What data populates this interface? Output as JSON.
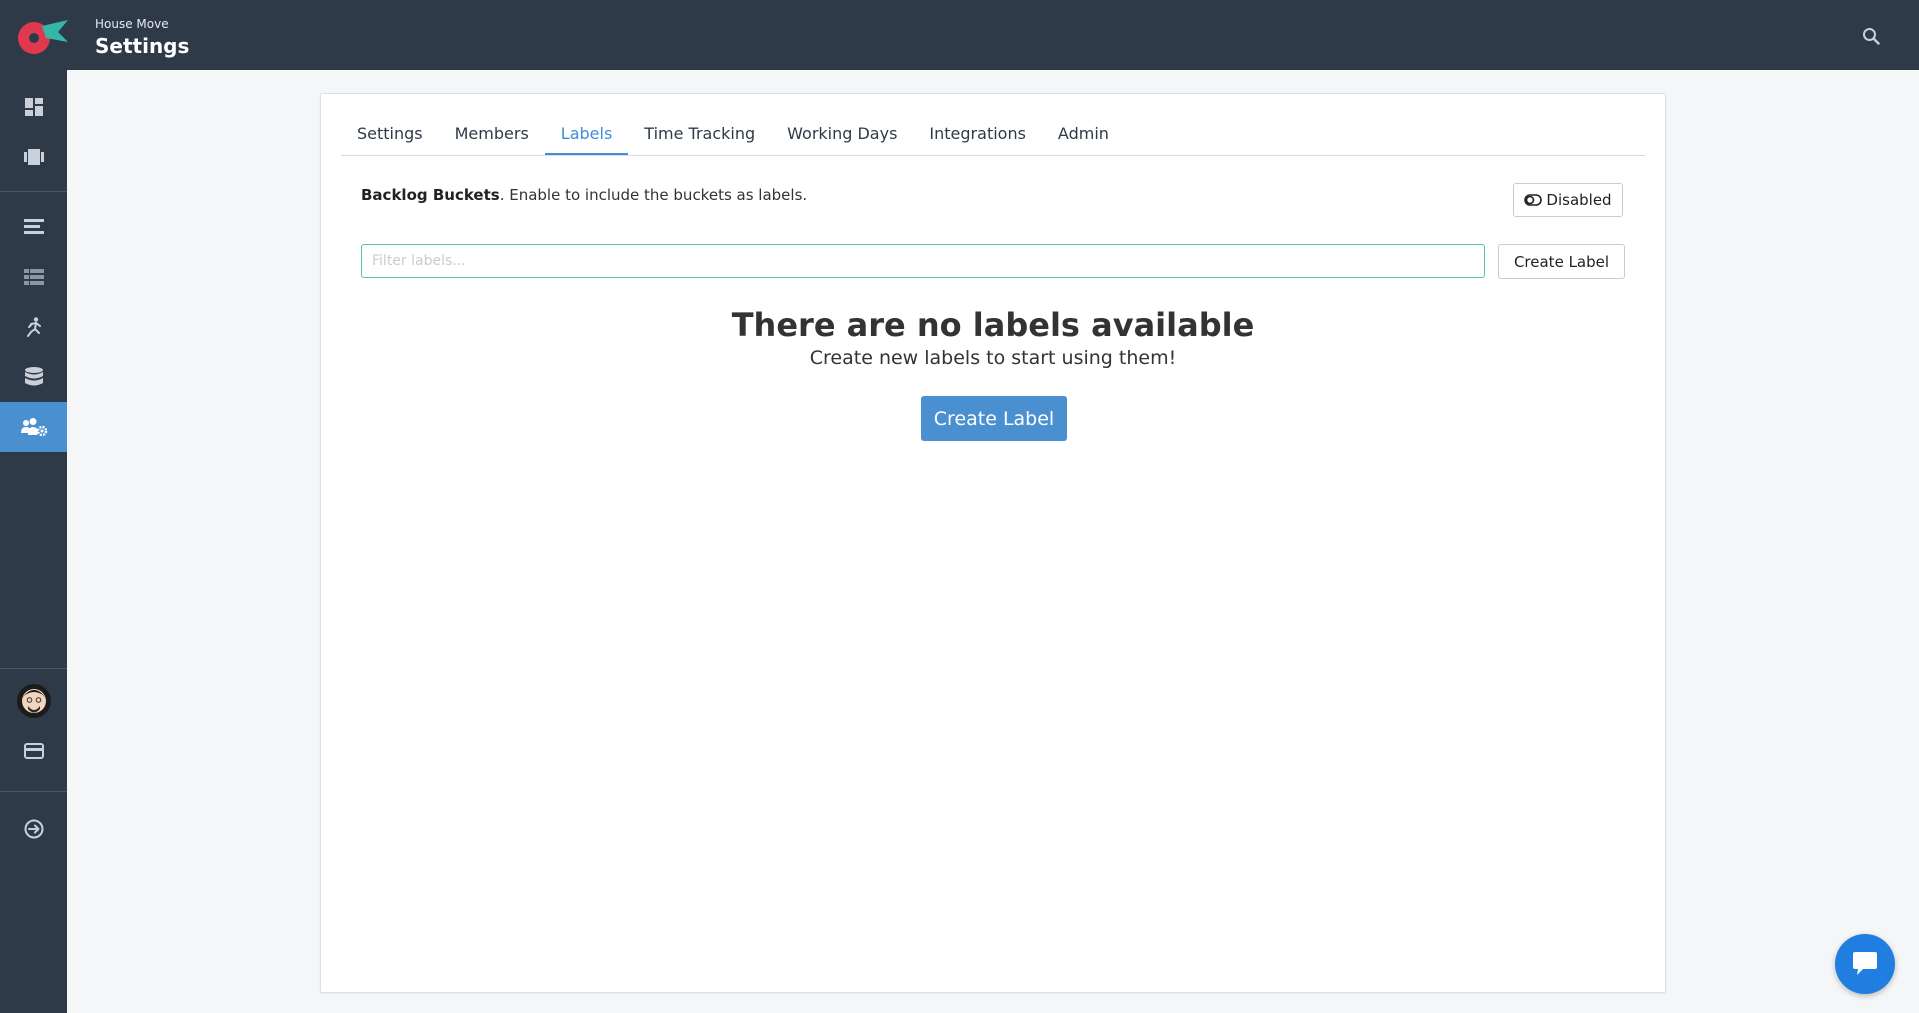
{
  "header": {
    "project_name": "House Move",
    "page_title": "Settings",
    "search_icon": "search-icon",
    "colors": {
      "bar": "#2f3a49",
      "accent": "#4a90d0"
    }
  },
  "sidebar": {
    "top_items": [
      {
        "icon": "dashboard-icon"
      },
      {
        "icon": "boards-icon"
      }
    ],
    "mid_items": [
      {
        "icon": "backlog-icon"
      },
      {
        "icon": "list-icon"
      },
      {
        "icon": "sprint-runner-icon"
      },
      {
        "icon": "database-icon"
      },
      {
        "icon": "team-settings-icon",
        "active": true
      }
    ],
    "bottom_items": [
      {
        "icon": "avatar"
      },
      {
        "icon": "billing-card-icon"
      },
      {
        "icon": "logout-icon"
      }
    ]
  },
  "tabs": [
    {
      "label": "Settings"
    },
    {
      "label": "Members"
    },
    {
      "label": "Labels",
      "active": true
    },
    {
      "label": "Time Tracking"
    },
    {
      "label": "Working Days"
    },
    {
      "label": "Integrations"
    },
    {
      "label": "Admin"
    }
  ],
  "backlog": {
    "title": "Backlog Buckets",
    "description": ". Enable to include the buckets as labels.",
    "toggle_label": "Disabled"
  },
  "filter": {
    "placeholder": "Filter labels...",
    "value": ""
  },
  "create_label_small": "Create Label",
  "empty_state": {
    "title": "There are no labels available",
    "subtitle": "Create new labels to start using them!",
    "button": "Create Label"
  }
}
